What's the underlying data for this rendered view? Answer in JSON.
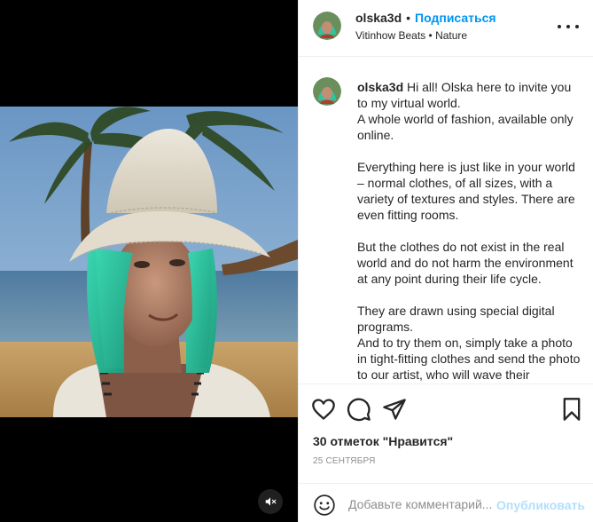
{
  "post": {
    "author": {
      "username": "olska3d",
      "follow_label": "Подписаться",
      "dot": "•",
      "audio_artist": "Vitinhow Beats",
      "audio_dot": "•",
      "audio_track": "Nature"
    },
    "caption": {
      "username": "olska3d",
      "p1": "Hi all! Olska here to invite you to my virtual world.",
      "p1b": "A whole world of fashion, available only online.",
      "p2": "Everything here is just like in your world – normal clothes, of all sizes, with a variety of textures and styles. There are even fitting rooms.",
      "p3": "But the clothes do not exist in the real world and do not harm the environment at any point during their life cycle.",
      "p4": "They are drawn using special digital programs.",
      "p4b": "And to try them on, simply take a photo in tight-fitting clothes and send the photo to our artist, who will wave their"
    },
    "likes_text": "30 отметок \"Нравится\"",
    "date": "25 СЕНТЯБРЯ"
  },
  "comment": {
    "placeholder": "Добавьте комментарий...",
    "publish_label": "Опубликовать"
  },
  "icons": {
    "like": "heart-icon",
    "comment": "comment-icon",
    "share": "paper-plane-icon",
    "save": "bookmark-icon",
    "emoji": "emoji-icon",
    "more": "more-options-icon",
    "mute": "muted-speaker-icon"
  },
  "colors": {
    "link_blue": "#0095f6",
    "publish_disabled": "#b2dffc",
    "secondary_text": "#8e8e8e",
    "border": "#efefef",
    "hair_teal": "#2ec4a0"
  }
}
